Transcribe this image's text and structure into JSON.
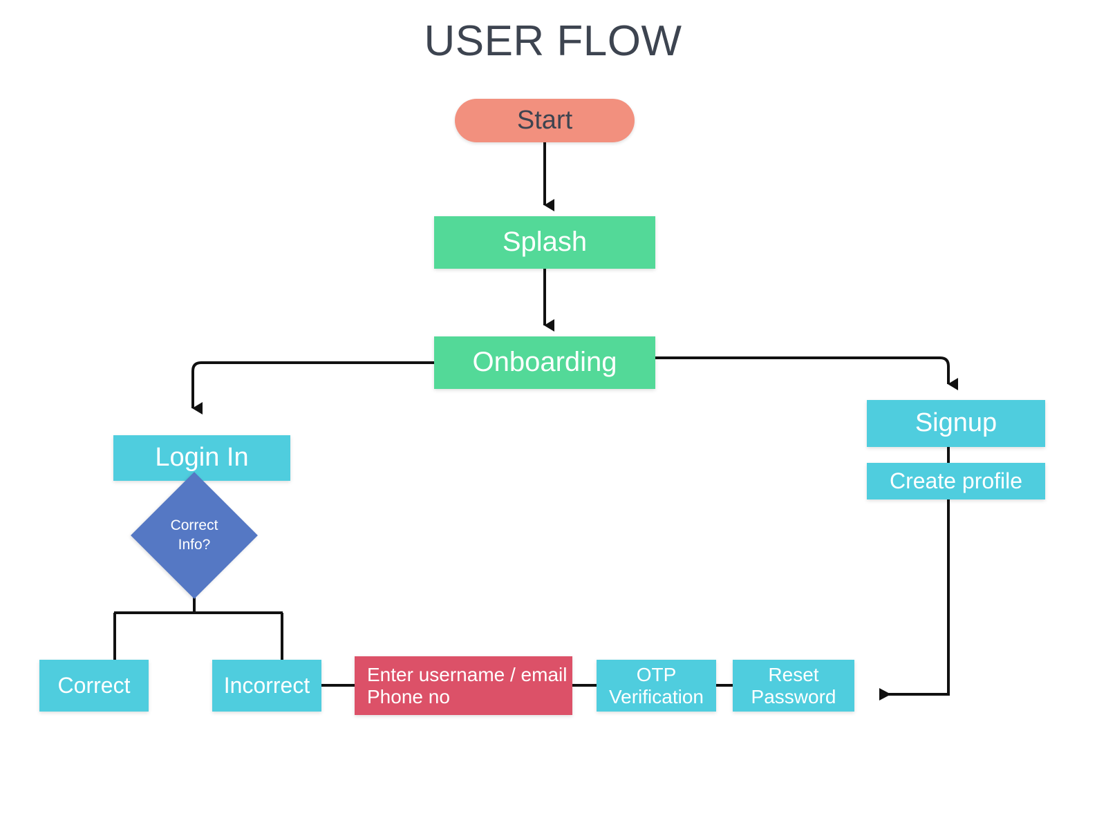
{
  "page": {
    "title": "USER FLOW",
    "background": "#ffffff",
    "title_color": "#3d4450"
  },
  "palette": {
    "start": "#f2907e",
    "green": "#53d998",
    "cyan": "#4fcdde",
    "red": "#dc5168",
    "diamond": "#5578c4",
    "edge": "#111111",
    "node_text": "#ffffff"
  },
  "chart_data": {
    "type": "diagram",
    "title": "USER FLOW",
    "nodes": [
      {
        "id": "start",
        "label": "Start",
        "shape": "pill",
        "color": "#f2907e"
      },
      {
        "id": "splash",
        "label": "Splash",
        "shape": "rect",
        "color": "#53d998"
      },
      {
        "id": "onboarding",
        "label": "Onboarding",
        "shape": "rect",
        "color": "#53d998"
      },
      {
        "id": "login",
        "label": "Login In",
        "shape": "rect",
        "color": "#4fcdde"
      },
      {
        "id": "correct_info",
        "label": "Correct\nInfo?",
        "shape": "diamond",
        "color": "#5578c4"
      },
      {
        "id": "correct",
        "label": "Correct",
        "shape": "rect",
        "color": "#4fcdde"
      },
      {
        "id": "incorrect",
        "label": "Incorrect",
        "shape": "rect",
        "color": "#4fcdde"
      },
      {
        "id": "enter_creds",
        "label": "Enter username / email\nPhone no",
        "shape": "rect",
        "color": "#dc5168"
      },
      {
        "id": "otp",
        "label": "OTP\nVerification",
        "shape": "rect",
        "color": "#4fcdde"
      },
      {
        "id": "reset",
        "label": "Reset\nPassword",
        "shape": "rect",
        "color": "#4fcdde"
      },
      {
        "id": "signup",
        "label": "Signup",
        "shape": "rect",
        "color": "#4fcdde"
      },
      {
        "id": "create_profile",
        "label": "Create profile",
        "shape": "rect",
        "color": "#4fcdde"
      }
    ],
    "edges": [
      {
        "from": "start",
        "to": "splash",
        "arrow": true
      },
      {
        "from": "splash",
        "to": "onboarding",
        "arrow": true
      },
      {
        "from": "onboarding",
        "to": "login",
        "arrow": true
      },
      {
        "from": "onboarding",
        "to": "signup",
        "arrow": true
      },
      {
        "from": "login",
        "to": "correct_info",
        "arrow": false
      },
      {
        "from": "correct_info",
        "to": "correct",
        "arrow": false
      },
      {
        "from": "correct_info",
        "to": "incorrect",
        "arrow": false
      },
      {
        "from": "incorrect",
        "to": "enter_creds",
        "arrow": false
      },
      {
        "from": "enter_creds",
        "to": "otp",
        "arrow": false
      },
      {
        "from": "otp",
        "to": "reset",
        "arrow": false
      },
      {
        "from": "signup",
        "to": "create_profile",
        "arrow": false
      },
      {
        "from": "create_profile",
        "to": "reset",
        "arrow": true
      }
    ]
  },
  "nodes": {
    "start": "Start",
    "splash": "Splash",
    "onboarding": "Onboarding",
    "login": "Login In",
    "correct_info": "Correct\nInfo?",
    "correct": "Correct",
    "incorrect": "Incorrect",
    "enter_creds": "Enter username / email\nPhone no",
    "otp": "OTP\nVerification",
    "reset": "Reset\nPassword",
    "signup": "Signup",
    "create_profile": "Create profile"
  }
}
